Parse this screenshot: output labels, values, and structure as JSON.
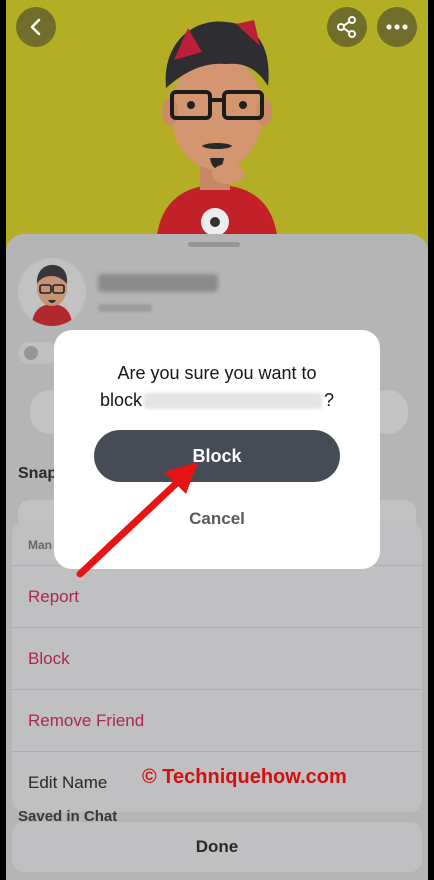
{
  "header": {
    "back_icon": "chevron-left-icon",
    "share_icon": "share-icon",
    "more_icon": "more-horizontal-icon",
    "background_color": "#b8b226"
  },
  "profile": {
    "section_label": "Snap"
  },
  "dialog": {
    "question_line1": "Are you sure you want to",
    "question_prefix": "block",
    "question_suffix": "?",
    "block_label": "Block",
    "cancel_label": "Cancel",
    "block_button_color": "#464c55"
  },
  "action_sheet": {
    "section_label": "Man",
    "items": [
      {
        "label": "Report"
      },
      {
        "label": "Block"
      },
      {
        "label": "Remove Friend"
      },
      {
        "label": "Edit Name"
      }
    ],
    "destructive_color": "#b1284f"
  },
  "footer": {
    "saved_label": "Saved in Chat",
    "done_label": "Done"
  },
  "watermark": {
    "text": "© Techniquehow.com",
    "color": "#d60e0e"
  },
  "annotation": {
    "arrow_color": "#e81414"
  }
}
